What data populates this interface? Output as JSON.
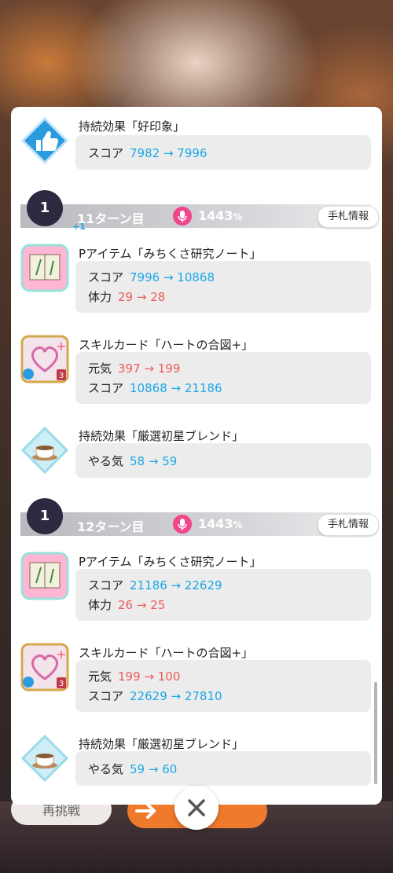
{
  "bottom": {
    "retry_label": "再挑戦"
  },
  "top_entry": {
    "title": "持続効果「好印象」",
    "stats": [
      {
        "label": "スコア",
        "value": "7982 → 7996",
        "color": "blue"
      }
    ]
  },
  "turns": [
    {
      "badge": "1",
      "plus": "+1",
      "label": "11ターン目",
      "percent": "1443",
      "percent_unit": "%",
      "hand_info": "手札情報",
      "entries": [
        {
          "icon": "notebook-item-icon",
          "title": "Pアイテム「みちくさ研究ノート」",
          "stats": [
            {
              "label": "スコア",
              "value": "7996 → 10868",
              "color": "blue"
            },
            {
              "label": "体力",
              "value": "29 → 28",
              "color": "red"
            }
          ]
        },
        {
          "icon": "heart-card-icon",
          "title": "スキルカード「ハートの合図+」",
          "stats": [
            {
              "label": "元気",
              "value": "397 → 199",
              "color": "red"
            },
            {
              "label": "スコア",
              "value": "10868 → 21186",
              "color": "blue"
            }
          ]
        },
        {
          "icon": "coffee-cup-icon",
          "title": "持続効果「厳選初星ブレンド」",
          "stats": [
            {
              "label": "やる気",
              "value": "58 → 59",
              "color": "blue"
            }
          ]
        }
      ]
    },
    {
      "badge": "1",
      "plus": "",
      "label": "12ターン目",
      "percent": "1443",
      "percent_unit": "%",
      "hand_info": "手札情報",
      "entries": [
        {
          "icon": "notebook-item-icon",
          "title": "Pアイテム「みちくさ研究ノート」",
          "stats": [
            {
              "label": "スコア",
              "value": "21186 → 22629",
              "color": "blue"
            },
            {
              "label": "体力",
              "value": "26 → 25",
              "color": "red"
            }
          ]
        },
        {
          "icon": "heart-card-icon",
          "title": "スキルカード「ハートの合図+」",
          "stats": [
            {
              "label": "元気",
              "value": "199 → 100",
              "color": "red"
            },
            {
              "label": "スコア",
              "value": "22629 → 27810",
              "color": "blue"
            }
          ]
        },
        {
          "icon": "coffee-cup-icon",
          "title": "持続効果「厳選初星ブレンド」",
          "stats": [
            {
              "label": "やる気",
              "value": "59 → 60",
              "color": "blue"
            }
          ]
        }
      ]
    }
  ],
  "colors": {
    "blue": "#1aa7e6",
    "red": "#ef5a5a",
    "accent_pink": "#f0468a",
    "badge_dark": "#2e2840"
  }
}
